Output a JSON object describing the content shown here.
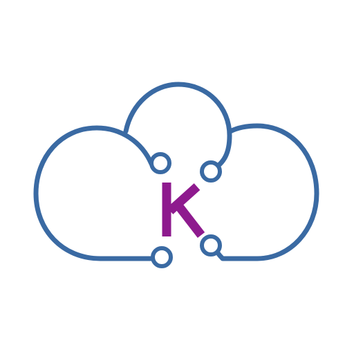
{
  "logo": {
    "name": "cloud-k-logo",
    "letter": "K",
    "colors": {
      "background": "#ffffff",
      "outline": "#3a6aa3",
      "letter": "#8e1a8e"
    },
    "icon": "cloud-icon"
  }
}
